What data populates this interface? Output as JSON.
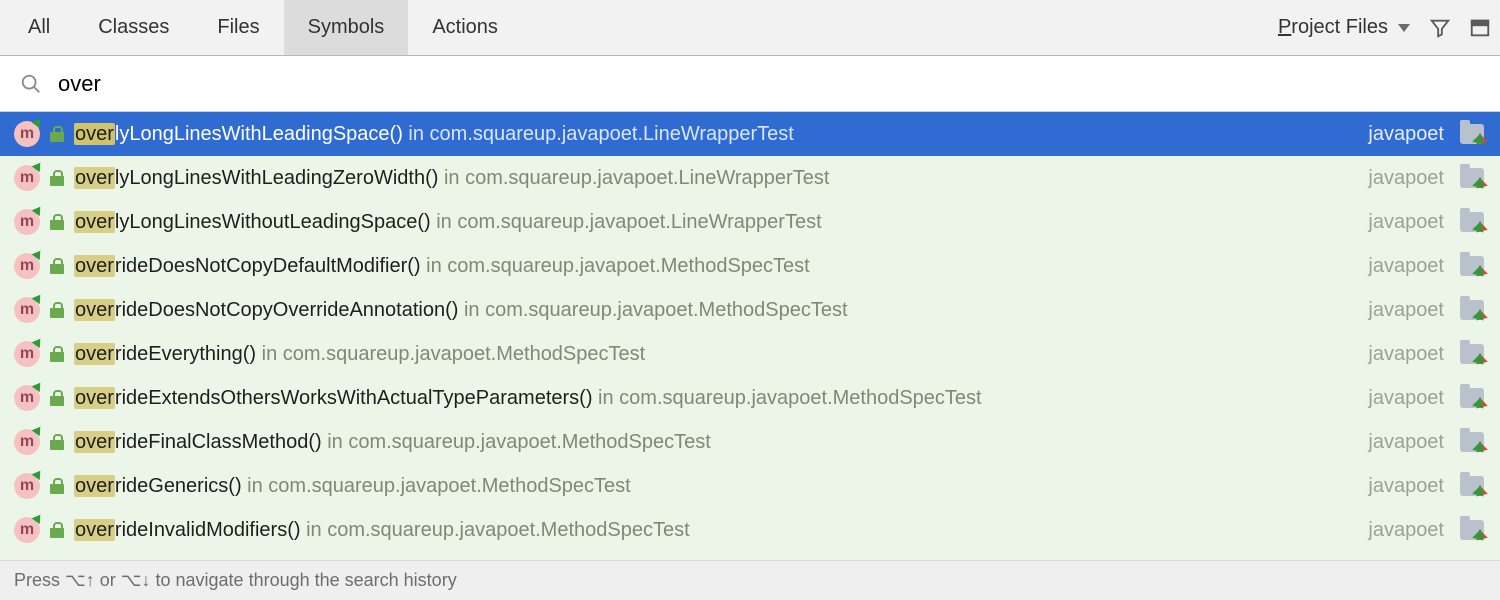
{
  "tabs": {
    "all": {
      "label": "All",
      "underline_index": -1
    },
    "classes": {
      "label": "Classes",
      "underline_index": -1
    },
    "files": {
      "label": "Files",
      "underline_index": -1
    },
    "symbols": {
      "label": "Symbols",
      "underline_index": -1
    },
    "actions": {
      "label": "Actions",
      "underline_index": -1
    }
  },
  "active_tab": "symbols",
  "scope": {
    "pre": "",
    "u": "P",
    "post": "roject Files"
  },
  "search": {
    "query": "over",
    "match_len": 4
  },
  "results": [
    {
      "name_match": "over",
      "name_rest": "lyLongLinesWithLeadingSpace()",
      "location": "com.squareup.javapoet.LineWrapperTest",
      "module": "javapoet",
      "selected": true,
      "has_run_arrow": true
    },
    {
      "name_match": "over",
      "name_rest": "lyLongLinesWithLeadingZeroWidth()",
      "location": "com.squareup.javapoet.LineWrapperTest",
      "module": "javapoet",
      "selected": false,
      "has_run_arrow": true
    },
    {
      "name_match": "over",
      "name_rest": "lyLongLinesWithoutLeadingSpace()",
      "location": "com.squareup.javapoet.LineWrapperTest",
      "module": "javapoet",
      "selected": false,
      "has_run_arrow": true
    },
    {
      "name_match": "over",
      "name_rest": "rideDoesNotCopyDefaultModifier()",
      "location": "com.squareup.javapoet.MethodSpecTest",
      "module": "javapoet",
      "selected": false,
      "has_run_arrow": true
    },
    {
      "name_match": "over",
      "name_rest": "rideDoesNotCopyOverrideAnnotation()",
      "location": "com.squareup.javapoet.MethodSpecTest",
      "module": "javapoet",
      "selected": false,
      "has_run_arrow": true
    },
    {
      "name_match": "over",
      "name_rest": "rideEverything()",
      "location": "com.squareup.javapoet.MethodSpecTest",
      "module": "javapoet",
      "selected": false,
      "has_run_arrow": true
    },
    {
      "name_match": "over",
      "name_rest": "rideExtendsOthersWorksWithActualTypeParameters()",
      "location": "com.squareup.javapoet.MethodSpecTest",
      "module": "javapoet",
      "selected": false,
      "has_run_arrow": true
    },
    {
      "name_match": "over",
      "name_rest": "rideFinalClassMethod()",
      "location": "com.squareup.javapoet.MethodSpecTest",
      "module": "javapoet",
      "selected": false,
      "has_run_arrow": true
    },
    {
      "name_match": "over",
      "name_rest": "rideGenerics()",
      "location": "com.squareup.javapoet.MethodSpecTest",
      "module": "javapoet",
      "selected": false,
      "has_run_arrow": true
    },
    {
      "name_match": "over",
      "name_rest": "rideInvalidModifiers()",
      "location": "com.squareup.javapoet.MethodSpecTest",
      "module": "javapoet",
      "selected": false,
      "has_run_arrow": true
    }
  ],
  "strings": {
    "in_sep": " in ",
    "footer_hint": "Press ⌥↑ or ⌥↓ to navigate through the search history",
    "method_glyph": "m"
  }
}
